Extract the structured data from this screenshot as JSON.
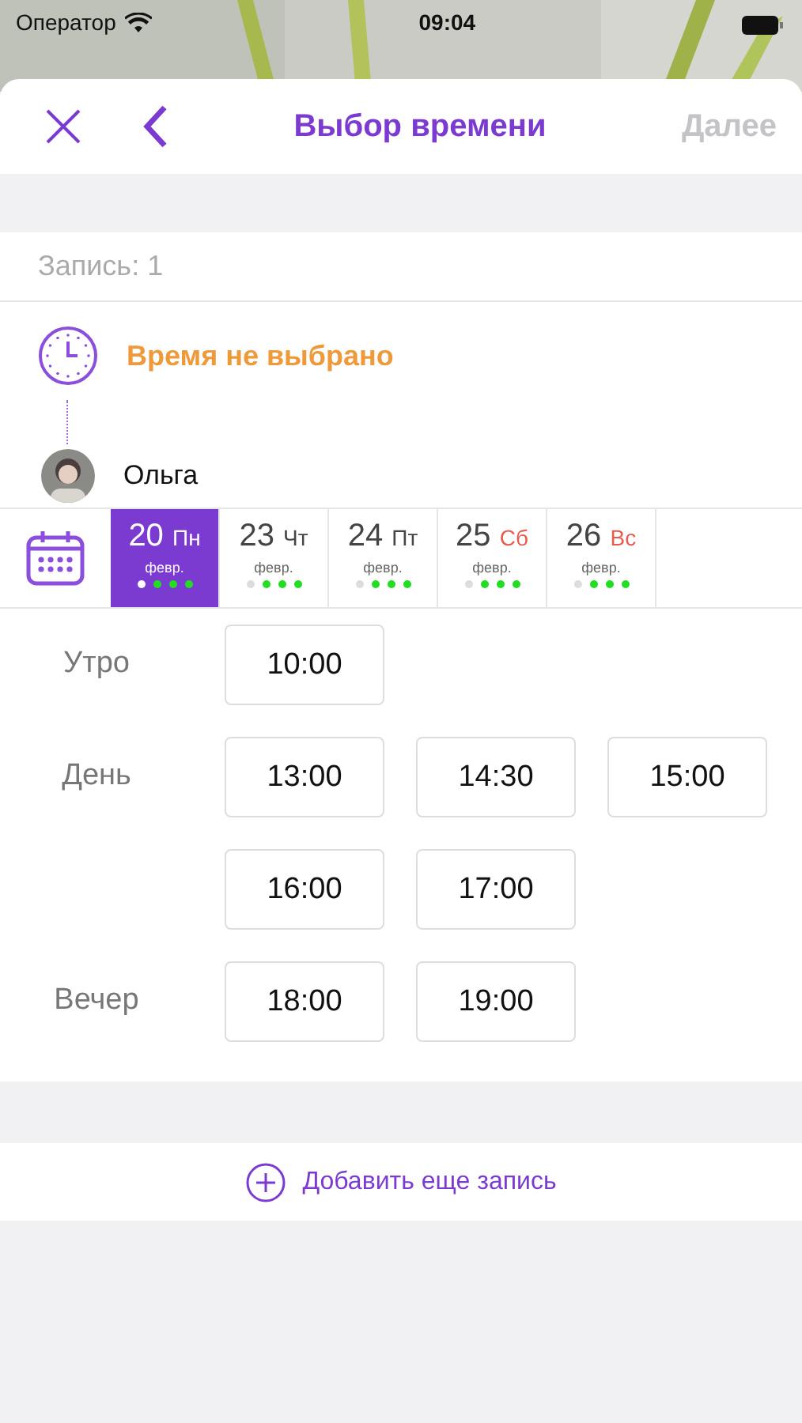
{
  "status_bar": {
    "carrier": "Оператор",
    "time": "09:04"
  },
  "header": {
    "title": "Выбор времени",
    "next": "Далее",
    "next_disabled": true
  },
  "booking": {
    "label": "Запись: 1",
    "time_status": "Время не выбрано",
    "master": "Ольга"
  },
  "days": [
    {
      "day": "20",
      "weekday": "Пн",
      "month": "февр.",
      "weekend": false,
      "selected": true,
      "slots": [
        {
          "available": false
        },
        {
          "available": true
        },
        {
          "available": true
        },
        {
          "available": true
        }
      ]
    },
    {
      "day": "23",
      "weekday": "Чт",
      "month": "февр.",
      "weekend": false,
      "selected": false,
      "slots": [
        {
          "available": false
        },
        {
          "available": true
        },
        {
          "available": true
        },
        {
          "available": true
        }
      ]
    },
    {
      "day": "24",
      "weekday": "Пт",
      "month": "февр.",
      "weekend": false,
      "selected": false,
      "slots": [
        {
          "available": false
        },
        {
          "available": true
        },
        {
          "available": true
        },
        {
          "available": true
        }
      ]
    },
    {
      "day": "25",
      "weekday": "Сб",
      "month": "февр.",
      "weekend": true,
      "selected": false,
      "slots": [
        {
          "available": false
        },
        {
          "available": true
        },
        {
          "available": true
        },
        {
          "available": true
        }
      ]
    },
    {
      "day": "26",
      "weekday": "Вс",
      "month": "февр.",
      "weekend": true,
      "selected": false,
      "slots": [
        {
          "available": false
        },
        {
          "available": true
        },
        {
          "available": true
        },
        {
          "available": true
        }
      ]
    }
  ],
  "periods": [
    {
      "label": "Утро",
      "times": [
        "10:00"
      ]
    },
    {
      "label": "День",
      "times": [
        "13:00",
        "14:30",
        "15:00",
        "16:00",
        "17:00"
      ]
    },
    {
      "label": "Вечер",
      "times": [
        "18:00",
        "19:00"
      ]
    }
  ],
  "add_button": "Добавить еще запись"
}
